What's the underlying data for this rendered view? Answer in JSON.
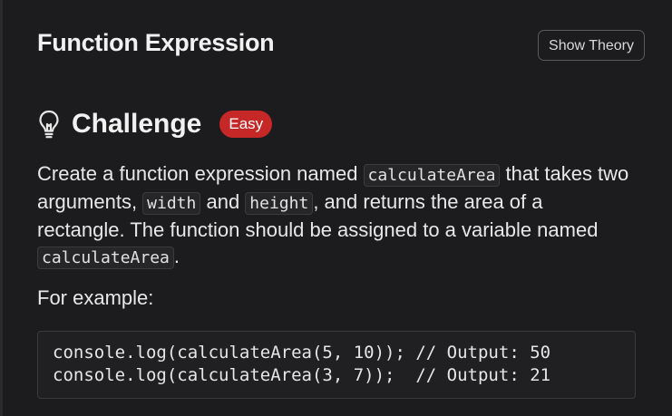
{
  "header": {
    "title": "Function Expression",
    "theory_button_label": "Show Theory"
  },
  "challenge": {
    "icon": "lightbulb-icon",
    "heading": "Challenge",
    "difficulty": "Easy",
    "difficulty_color": "#c62828"
  },
  "description": {
    "part1": "Create a function expression named ",
    "code1": "calculateArea",
    "part2": " that takes two arguments, ",
    "code2": "width",
    "part3": " and ",
    "code3": "height",
    "part4": ", and returns the area of a rectangle. The function should be assigned to a variable named ",
    "code4": "calculateArea",
    "part5": "."
  },
  "example": {
    "label": "For example:",
    "code_lines": [
      "console.log(calculateArea(5, 10)); // Output: 50",
      "console.log(calculateArea(3, 7));  // Output: 21"
    ]
  }
}
